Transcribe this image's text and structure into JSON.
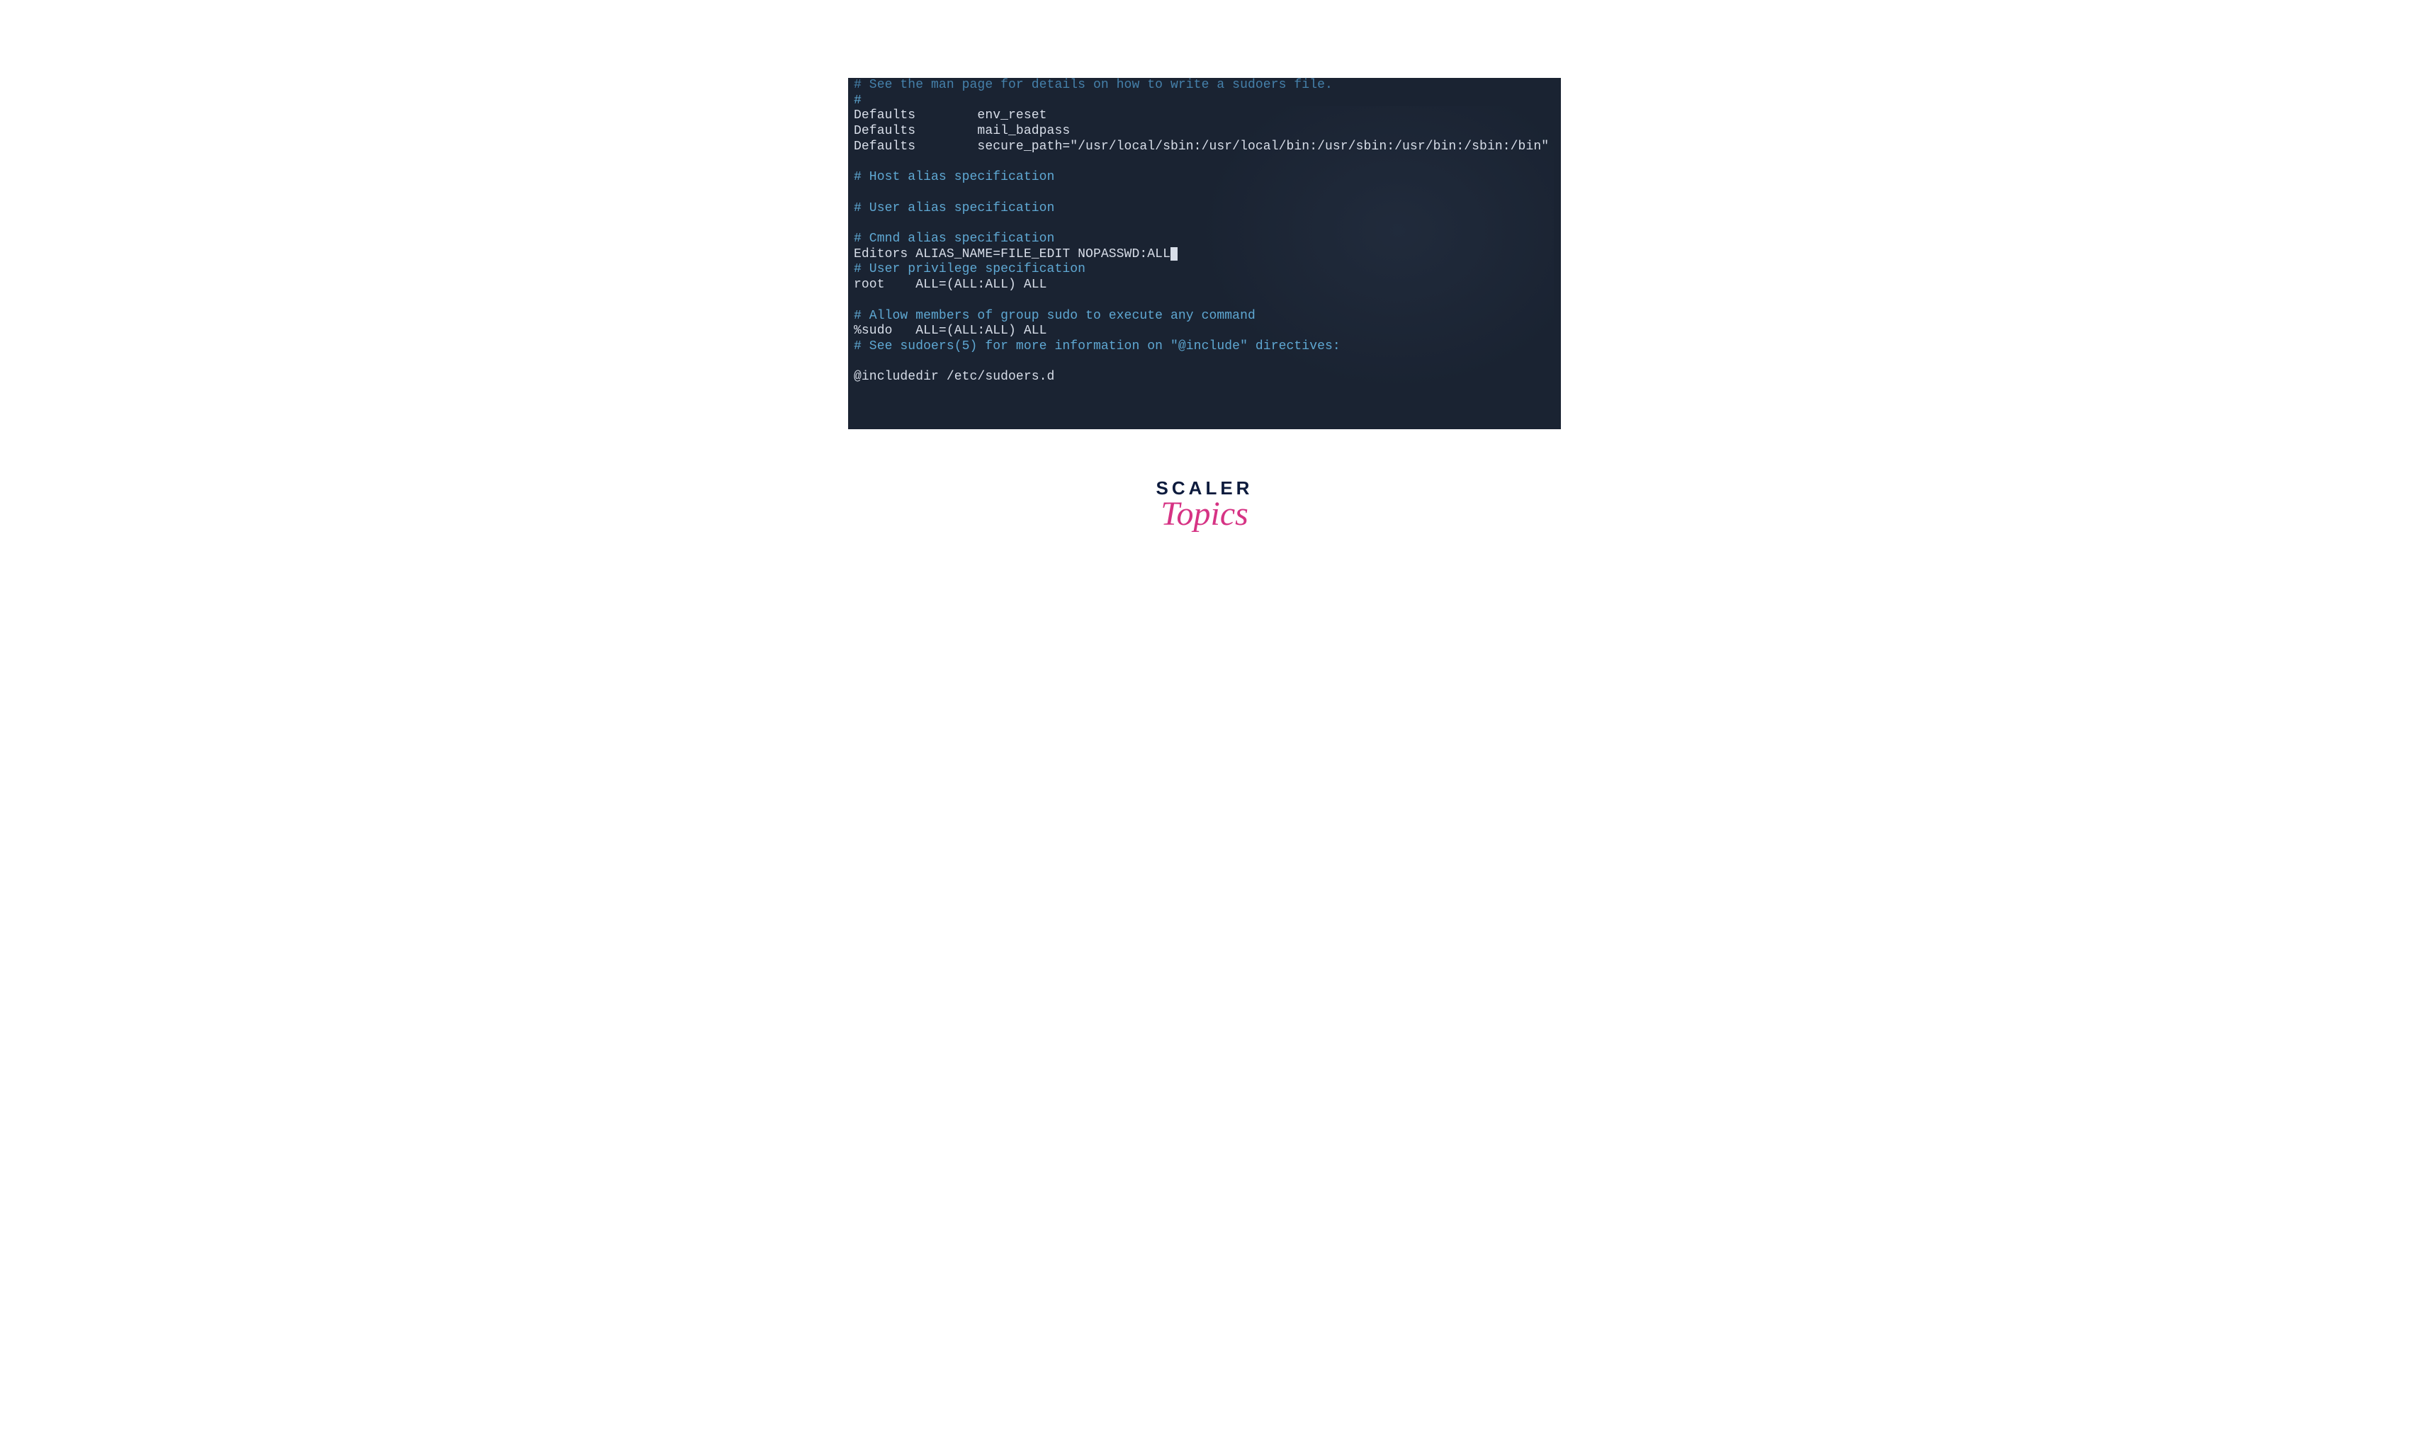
{
  "terminal": {
    "lines": [
      {
        "text": "# See the man page for details on how to write a sudoers file.",
        "class": "faded-top"
      },
      {
        "text": "#",
        "class": "comment"
      },
      {
        "text": "Defaults        env_reset",
        "class": "white"
      },
      {
        "text": "Defaults        mail_badpass",
        "class": "white"
      },
      {
        "text": "Defaults        secure_path=\"/usr/local/sbin:/usr/local/bin:/usr/sbin:/usr/bin:/sbin:/bin\"",
        "class": "white"
      },
      {
        "text": "",
        "class": "white"
      },
      {
        "text": "# Host alias specification",
        "class": "comment"
      },
      {
        "text": "",
        "class": "white"
      },
      {
        "text": "# User alias specification",
        "class": "comment"
      },
      {
        "text": "",
        "class": "white"
      },
      {
        "text": "# Cmnd alias specification",
        "class": "comment"
      },
      {
        "text": "Editors ALIAS_NAME=FILE_EDIT NOPASSWD:ALL",
        "class": "white",
        "cursor": true
      },
      {
        "text": "# User privilege specification",
        "class": "comment"
      },
      {
        "text": "root    ALL=(ALL:ALL) ALL",
        "class": "white"
      },
      {
        "text": "",
        "class": "white"
      },
      {
        "text": "# Allow members of group sudo to execute any command",
        "class": "comment"
      },
      {
        "text": "%sudo   ALL=(ALL:ALL) ALL",
        "class": "white"
      },
      {
        "text": "# See sudoers(5) for more information on \"@include\" directives:",
        "class": "comment"
      },
      {
        "text": "",
        "class": "white"
      },
      {
        "text": "@includedir /etc/sudoers.d",
        "class": "white"
      }
    ]
  },
  "logo": {
    "scaler": "SCALER",
    "topics": "Topics"
  }
}
